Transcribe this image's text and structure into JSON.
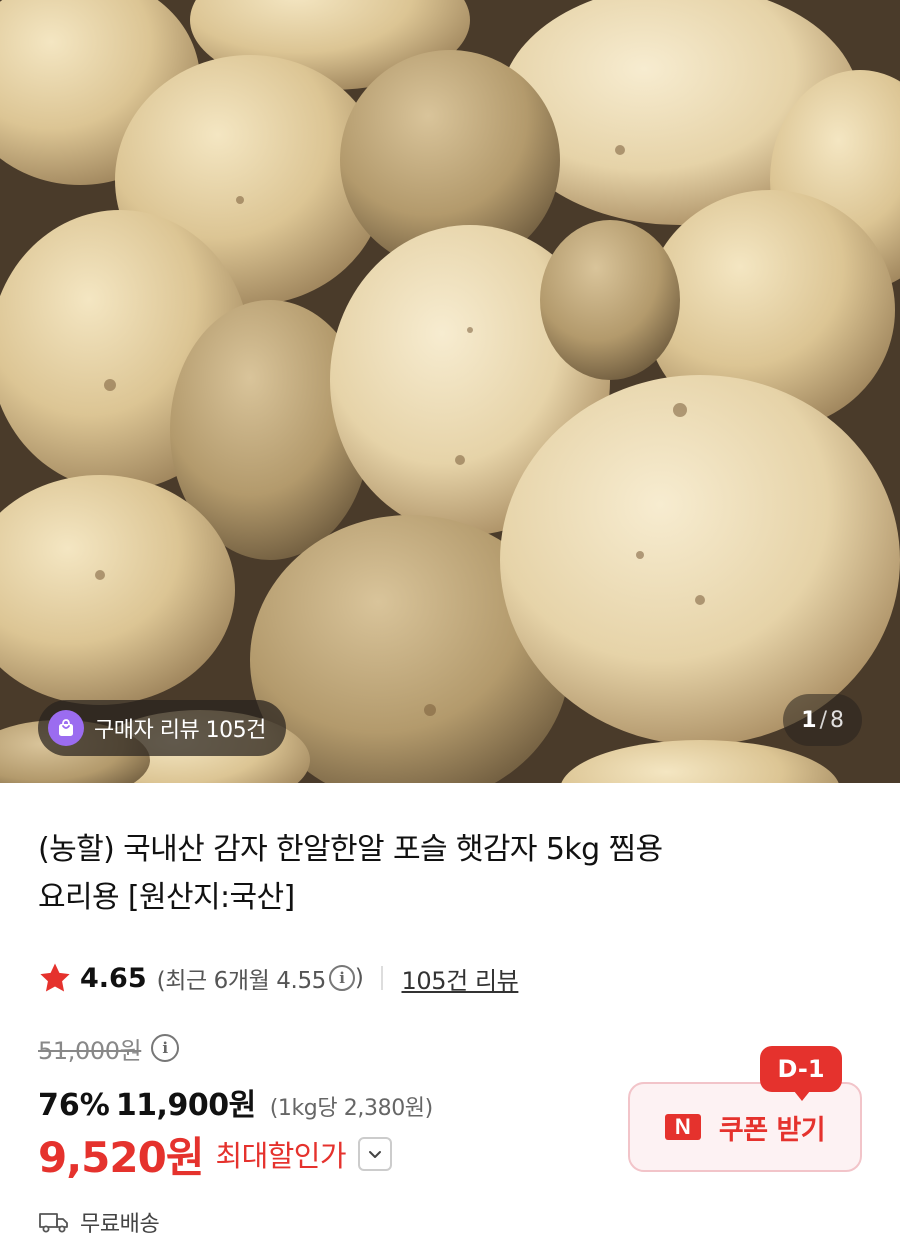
{
  "hero": {
    "review_chip": "구매자 리뷰 105건",
    "counter_current": "1",
    "counter_sep": "/",
    "counter_total": "8"
  },
  "product": {
    "title_line1": "(농할) 국내산 감자 한알한알 포슬 햇감자 5kg 찜용",
    "title_line2": "요리용 [원산지:국산]",
    "rating": "4.65",
    "recent_prefix": "(최근 6개월 4.55",
    "recent_suffix": ")",
    "info_glyph": "i",
    "review_link": "105건 리뷰",
    "original_price": "51,000원",
    "discount": "76%",
    "sale_price": "11,900원",
    "unit_price": "(1kg당 2,380원)",
    "final_price": "9,520원",
    "max_discount_label": "최대할인가",
    "shipping": "무료배송"
  },
  "coupon": {
    "dday": "D-1",
    "n_icon": "N",
    "label": "쿠폰 받기"
  },
  "colors": {
    "accent_red": "#e5322d",
    "coupon_bg": "#fdf2f3",
    "chip_purple": "#9b6cf0"
  },
  "icons": [
    "shopping-bag-icon",
    "star-icon",
    "info-icon",
    "chevron-down-icon",
    "truck-icon",
    "naver-n-icon"
  ]
}
